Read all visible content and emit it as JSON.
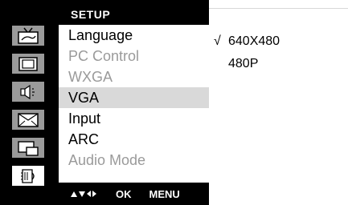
{
  "title": "SETUP",
  "menu": {
    "items": [
      {
        "label": "Language",
        "state": "normal"
      },
      {
        "label": "PC Control",
        "state": "dim"
      },
      {
        "label": "WXGA",
        "state": "dim"
      },
      {
        "label": "VGA",
        "state": "selected"
      },
      {
        "label": "Input",
        "state": "normal"
      },
      {
        "label": "ARC",
        "state": "normal"
      },
      {
        "label": "Audio Mode",
        "state": "dim"
      }
    ]
  },
  "icons": [
    {
      "name": "tv-icon",
      "active": false
    },
    {
      "name": "picture-icon",
      "active": false
    },
    {
      "name": "sound-icon",
      "active": false
    },
    {
      "name": "screen-icon",
      "active": false
    },
    {
      "name": "pip-icon",
      "active": false
    },
    {
      "name": "setup-icon",
      "active": true
    }
  ],
  "footer": {
    "arrows_icon": "navigation-arrows-icon",
    "ok_label": "OK",
    "menu_label": "MENU"
  },
  "options": [
    {
      "check": "√",
      "label": "640X480",
      "checked": true
    },
    {
      "check": "",
      "label": "480P",
      "checked": false
    }
  ],
  "colors": {
    "frame": "#000000",
    "icon_inactive": "#9a9a9a",
    "icon_active": "#ffffff",
    "selected_row": "#d9d9d9",
    "dim_text": "#9a9a9a"
  }
}
